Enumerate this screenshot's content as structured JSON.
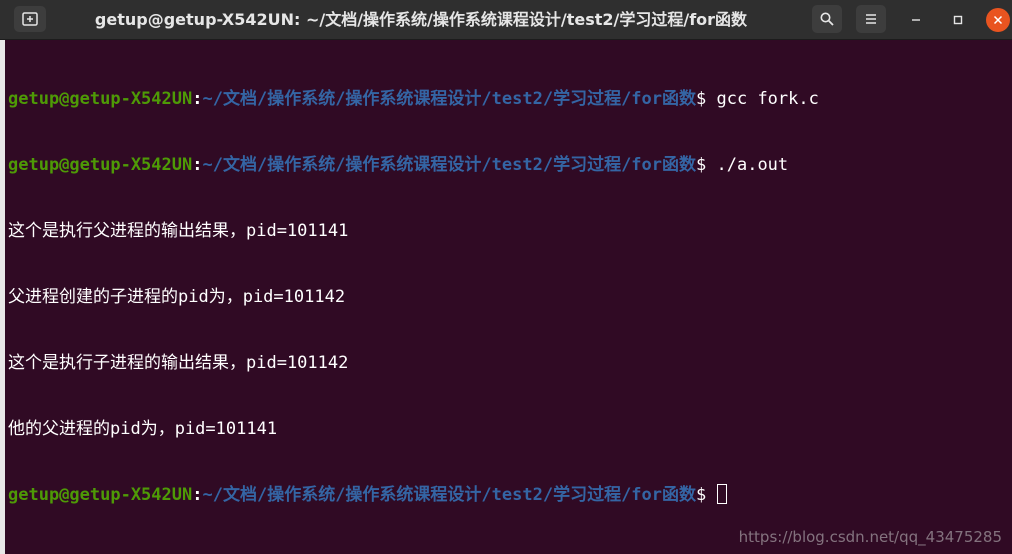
{
  "window": {
    "title": "getup@getup-X542UN: ~/文档/操作系统/操作系统课程设计/test2/学习过程/for函数",
    "icons": {
      "new_tab": "new-tab-icon",
      "search": "search-icon",
      "menu": "hamburger-menu-icon",
      "minimize": "minimize-icon",
      "maximize": "maximize-icon",
      "close": "close-icon"
    }
  },
  "terminal": {
    "prompt_user": "getup@getup-X542UN",
    "prompt_sep": ":",
    "prompt_path": "~/文档/操作系统/操作系统课程设计/test2/学习过程/for函数",
    "prompt_symbol": "$ ",
    "commands": [
      "gcc fork.c",
      "./a.out"
    ],
    "output": [
      "这个是执行父进程的输出结果，pid=101141",
      "父进程创建的子进程的pid为，pid=101142",
      "这个是执行子进程的输出结果，pid=101142",
      "他的父进程的pid为，pid=101141"
    ]
  },
  "watermark": "https://blog.csdn.net/qq_43475285",
  "colors": {
    "background": "#300a24",
    "user": "#4e9a06",
    "path": "#3465a4",
    "close_button": "#e95420",
    "titlebar": "#2f2f2f"
  }
}
